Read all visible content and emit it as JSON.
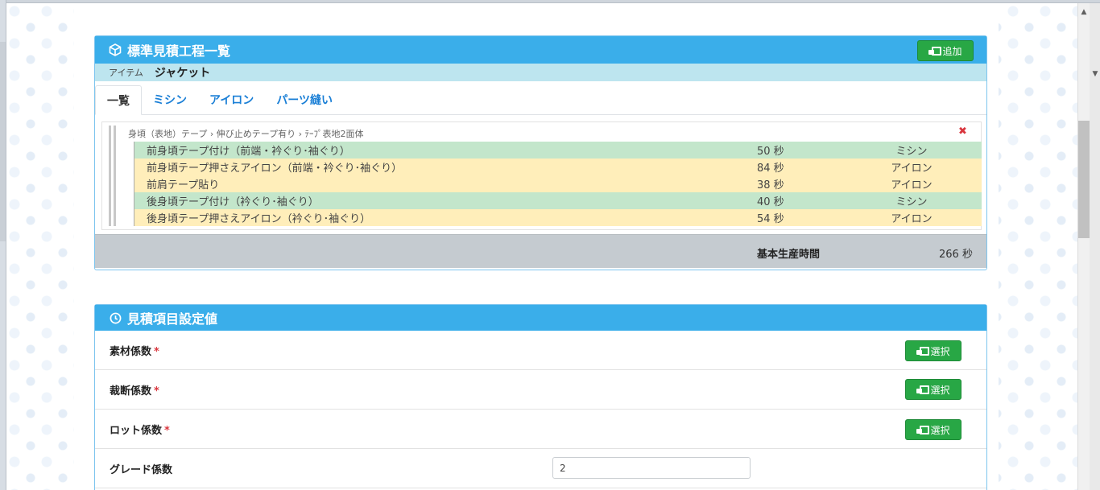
{
  "panel1": {
    "title": "標準見積工程一覧",
    "add_label": "追加",
    "item_label": "アイテム",
    "item_value": "ジャケット",
    "tabs": [
      {
        "label": "一覧"
      },
      {
        "label": "ミシン"
      },
      {
        "label": "アイロン"
      },
      {
        "label": "パーツ縫い"
      }
    ],
    "process_path": "身頃（表地）テープ › 伸び止めテープ有り › ﾃｰﾌﾟ表地2面体",
    "rows": [
      {
        "name": "前身頃テープ付け（前端・衿ぐり･袖ぐり）",
        "seconds": "50 秒",
        "type": "ミシン",
        "kind": "mishin"
      },
      {
        "name": "前身頃テープ押さえアイロン（前端・衿ぐり･袖ぐり）",
        "seconds": "84 秒",
        "type": "アイロン",
        "kind": "iron"
      },
      {
        "name": "前肩テープ貼り",
        "seconds": "38 秒",
        "type": "アイロン",
        "kind": "iron"
      },
      {
        "name": "後身頃テープ付け（衿ぐり･袖ぐり）",
        "seconds": "40 秒",
        "type": "ミシン",
        "kind": "mishin"
      },
      {
        "name": "後身頃テープ押さえアイロン（衿ぐり･袖ぐり）",
        "seconds": "54 秒",
        "type": "アイロン",
        "kind": "iron"
      }
    ],
    "total_label": "基本生産時間",
    "total_value": "266 秒"
  },
  "panel2": {
    "title": "見積項目設定値",
    "select_label": "選択",
    "required_mark": "*",
    "fields": [
      {
        "label": "素材係数",
        "required": true
      },
      {
        "label": "裁断係数",
        "required": true
      },
      {
        "label": "ロット係数",
        "required": true
      },
      {
        "label": "グレード係数",
        "required": false,
        "value": "2"
      }
    ]
  },
  "colors": {
    "header_blue": "#3aaeea",
    "item_bar": "#bde5ef",
    "mishin_row": "#c3e6cb",
    "iron_row": "#ffeeba",
    "button_green": "#28a745",
    "required_red": "#d9363e"
  }
}
